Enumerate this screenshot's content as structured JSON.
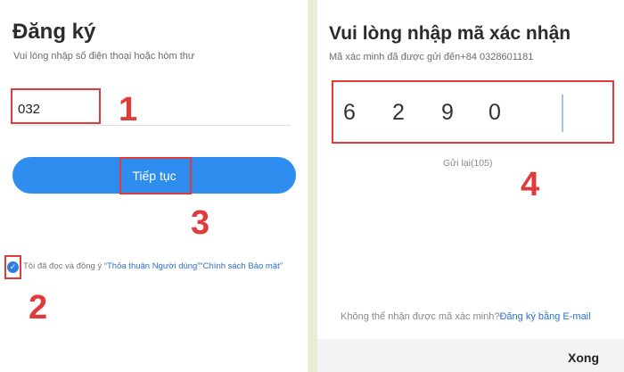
{
  "signup": {
    "title": "Đăng ký",
    "subtitle": "Vui lòng nhập số điện thoại hoặc hòm thư",
    "phone_value": "032",
    "continue_label": "Tiếp tục",
    "terms_prefix": "Tôi đã đọc và đồng ý",
    "terms_link_1": "“Thỏa thuận Người dùng”",
    "terms_link_2": "“Chính sách Bảo mật”"
  },
  "verify": {
    "title": "Vui lòng nhập mã xác nhận",
    "sent_text": "Mã xác minh đã được gửi đến+84 0328601181",
    "digits": [
      "6",
      "2",
      "9",
      "0"
    ],
    "resend_label": "Gửi lại(105)",
    "cant_receive_text": "Không thể nhận được mã xác minh?",
    "email_signup_link": "Đăng ký bằng E-mail",
    "done_label": "Xong"
  },
  "annotations": {
    "step1": "1",
    "step2": "2",
    "step3": "3",
    "step4": "4",
    "color": "#e03a3a"
  },
  "colors": {
    "primary_button": "#2f8df0",
    "link": "#2f6fd0",
    "divider": "#ecebd6"
  }
}
